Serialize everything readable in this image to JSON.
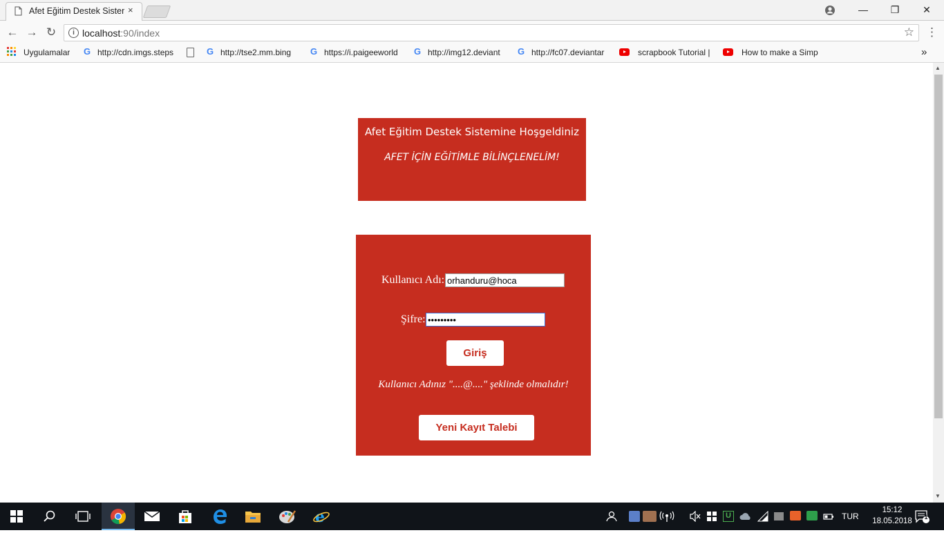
{
  "browser": {
    "tab_title": "Afet Eğitim Destek Sistemi",
    "tab_close": "×",
    "address": {
      "host": "localhost",
      "path": ":90/index"
    },
    "window_controls": {
      "minimize": "—",
      "restore": "❐",
      "close": "✕"
    },
    "nav": {
      "back": "←",
      "forward": "→",
      "reload": "↻",
      "menu": "⋮",
      "star": "☆",
      "info": "i"
    }
  },
  "bookmarks": {
    "apps_label": "Uygulamalar",
    "items": [
      {
        "icon": "google-icon",
        "label": "http://cdn.imgs.steps"
      },
      {
        "icon": "document-icon",
        "label": ""
      },
      {
        "icon": "google-icon",
        "label": "http://tse2.mm.bing"
      },
      {
        "icon": "google-icon",
        "label": "https://i.paigeeworld"
      },
      {
        "icon": "google-icon",
        "label": "http://img12.deviant"
      },
      {
        "icon": "google-icon",
        "label": "http://fc07.deviantar"
      },
      {
        "icon": "youtube-icon",
        "label": "scrapbook Tutorial |"
      },
      {
        "icon": "youtube-icon",
        "label": "How to make a Simp"
      }
    ],
    "overflow": "»"
  },
  "page": {
    "welcome_title": "Afet Eğitim Destek Sistemine Hoşgeldiniz",
    "welcome_slogan": "AFET İÇİN EĞİTİMLE BİLİNÇLENELİM!",
    "login": {
      "username_label": "Kullanıcı Adı:",
      "username_value": "orhanduru@hoca",
      "password_label": "Şifre:",
      "password_value": "•••••••••",
      "submit_label": "Giriş",
      "hint": "Kullanıcı Adınız \"....@....\" şeklinde olmalıdır!",
      "register_label": "Yeni Kayıt Talebi"
    }
  },
  "taskbar": {
    "language": "TUR",
    "time": "15:12",
    "date": "18.05.2018",
    "notifications": "1"
  },
  "colors": {
    "panel_red": "#c62d1f",
    "taskbar": "#101419"
  }
}
